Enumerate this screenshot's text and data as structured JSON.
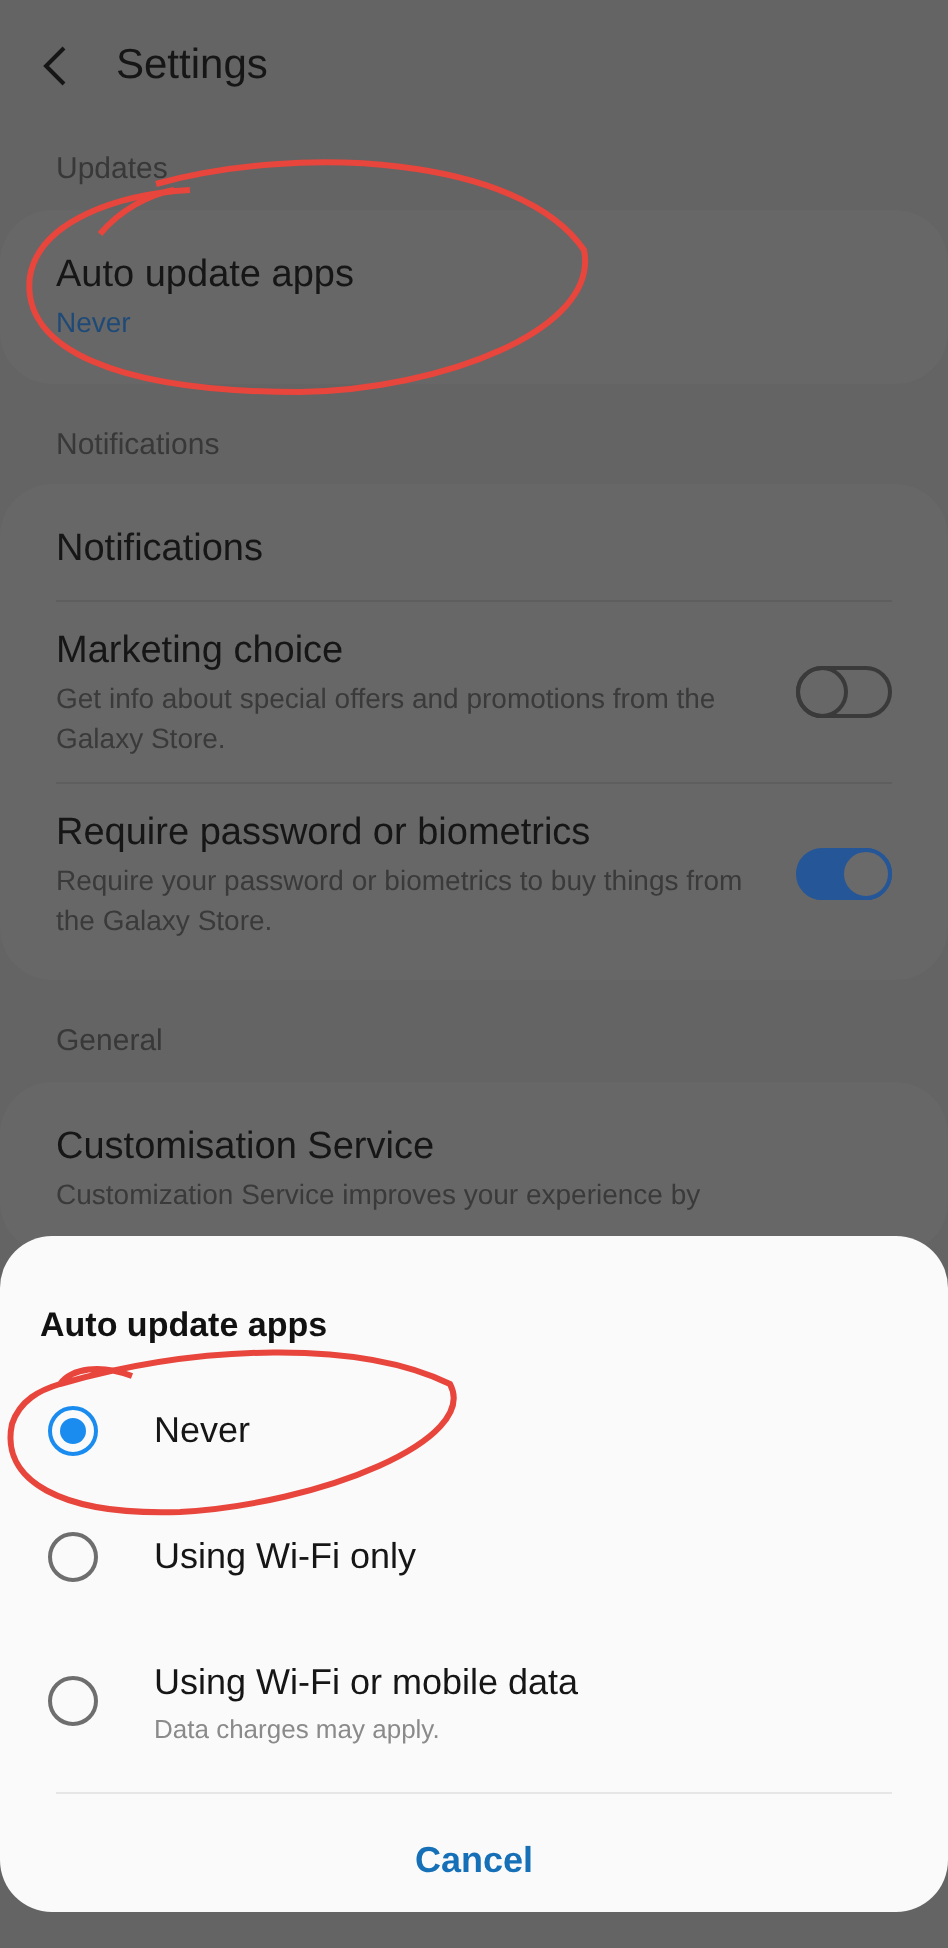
{
  "header": {
    "title": "Settings"
  },
  "sections": [
    {
      "label": "Updates",
      "items": [
        {
          "kind": "link",
          "title": "Auto update apps",
          "value": "Never"
        }
      ]
    },
    {
      "label": "Notifications",
      "items": [
        {
          "kind": "link",
          "title": "Notifications"
        },
        {
          "kind": "switch",
          "title": "Marketing choice",
          "description": "Get info about special offers and promotions from the Galaxy Store.",
          "on": false
        },
        {
          "kind": "switch",
          "title": "Require password or biometrics",
          "description": "Require your password or biometrics to buy things from the Galaxy Store.",
          "on": true
        }
      ]
    },
    {
      "label": "General",
      "items": [
        {
          "kind": "link",
          "title": "Customisation Service",
          "description": "Customization Service improves your experience by"
        }
      ]
    }
  ],
  "dialog": {
    "title": "Auto update apps",
    "options": [
      {
        "label": "Never",
        "selected": true
      },
      {
        "label": "Using Wi-Fi only",
        "selected": false
      },
      {
        "label": "Using Wi-Fi or mobile data",
        "note": "Data charges may apply.",
        "selected": false
      }
    ],
    "button": "Cancel"
  }
}
